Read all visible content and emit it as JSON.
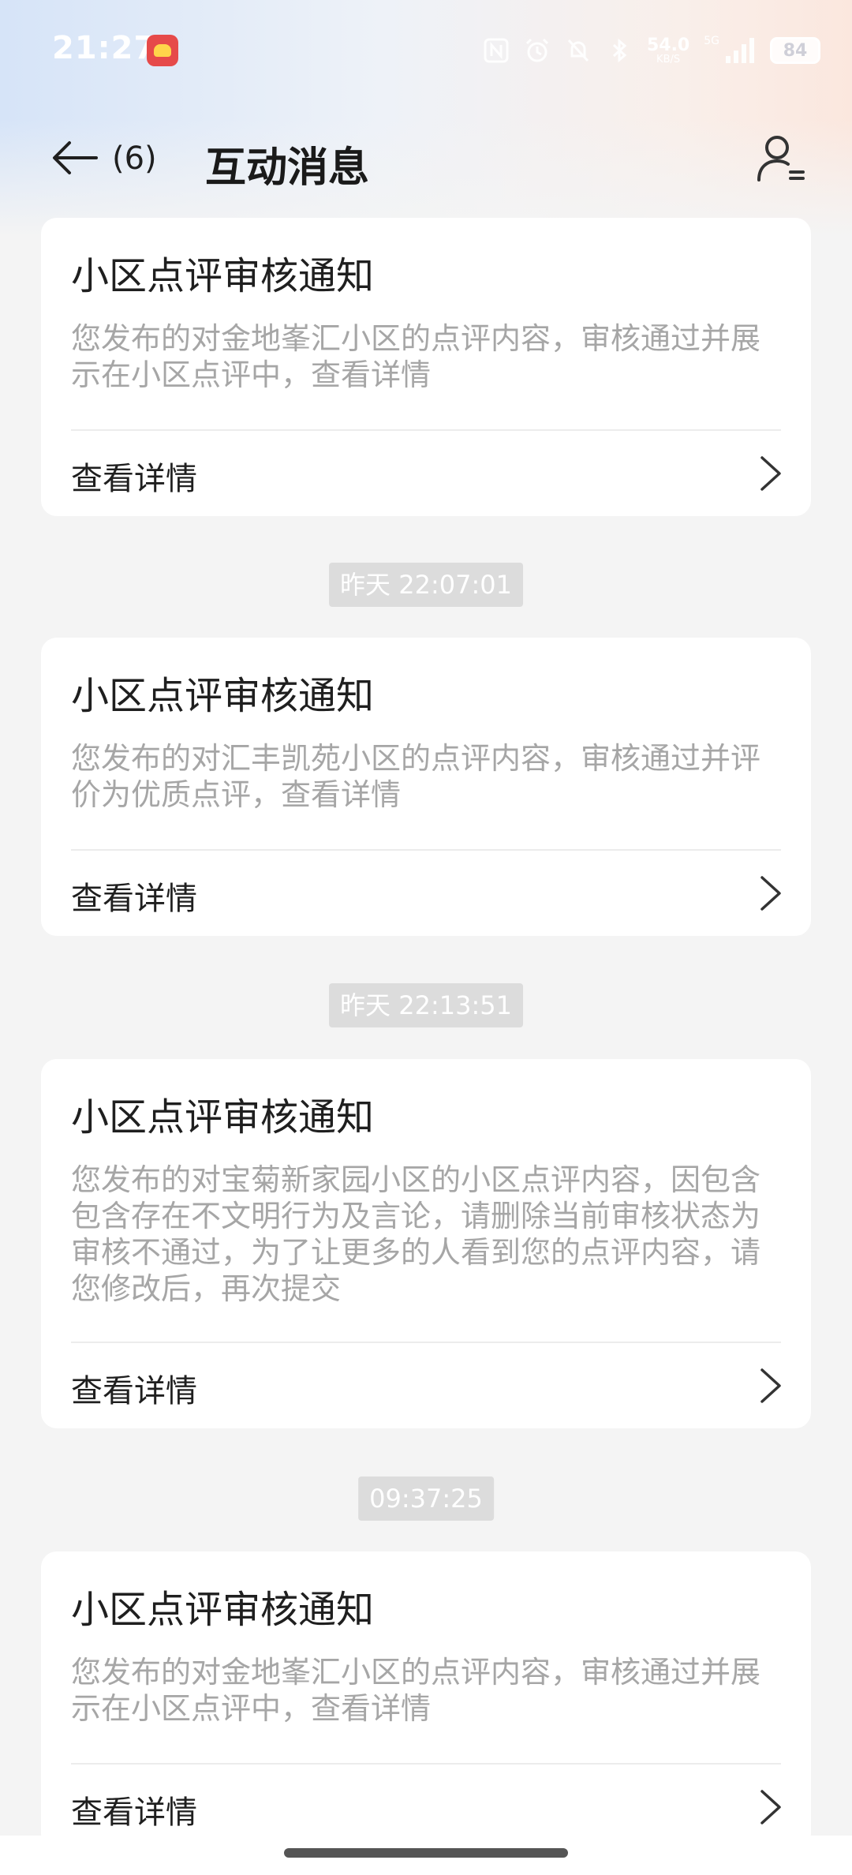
{
  "status_bar": {
    "time": "21:27",
    "network_speed": "54.0",
    "network_unit": "KB/S",
    "signal_label": "5G",
    "battery": "84"
  },
  "header": {
    "unread_count": "(6)",
    "title": "互动消息"
  },
  "notifications": [
    {
      "title": "小区点评审核通知",
      "body": "您发布的对金地峯汇小区的点评内容，审核通过并展示在小区点评中，查看详情",
      "link": "查看详情"
    },
    {
      "timestamp": "昨天 22:07:01",
      "title": "小区点评审核通知",
      "body": "您发布的对汇丰凯苑小区的点评内容，审核通过并评价为优质点评，查看详情",
      "link": "查看详情"
    },
    {
      "timestamp": "昨天 22:13:51",
      "title": "小区点评审核通知",
      "body": "您发布的对宝菊新家园小区的小区点评内容，因包含包含存在不文明行为及言论，请删除当前审核状态为审核不通过，为了让更多的人看到您的点评内容，请您修改后，再次提交",
      "link": "查看详情"
    },
    {
      "timestamp": "09:37:25",
      "title": "小区点评审核通知",
      "body": "您发布的对金地峯汇小区的点评内容，审核通过并展示在小区点评中，查看详情",
      "link": "查看详情"
    }
  ],
  "icons": {
    "back": "arrow-left-icon",
    "user": "user-list-icon",
    "chevron": "chevron-right-icon"
  },
  "colors": {
    "background": "#f4f4f4",
    "card": "#ffffff",
    "body_text": "#a6a6a6",
    "timestamp_bg": "#dcdcdc"
  }
}
